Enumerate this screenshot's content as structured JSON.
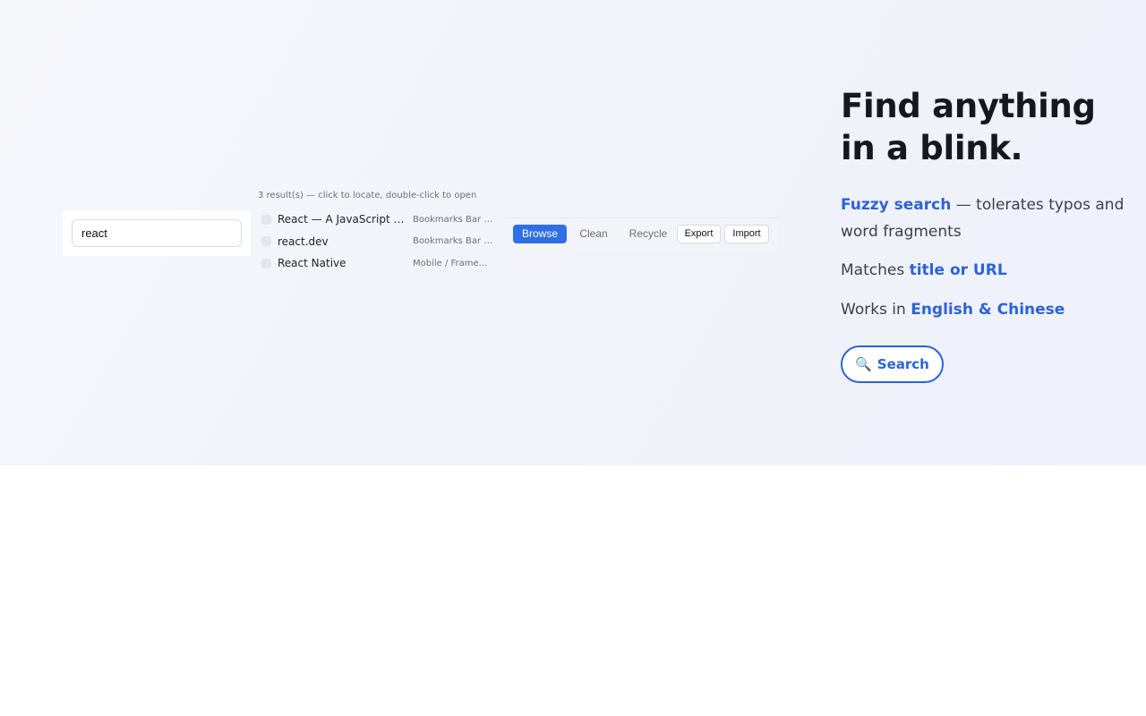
{
  "search": {
    "value": "react"
  },
  "results": {
    "hint": "3 result(s) — click to locate, double-click to open",
    "items": [
      {
        "title": "React — A JavaScript li...",
        "folder": "Bookmarks Bar /..."
      },
      {
        "title": "react.dev",
        "folder": "Bookmarks Bar /..."
      },
      {
        "title": "React Native",
        "folder": "Mobile / Frame..."
      }
    ]
  },
  "toolbar": {
    "browse": "Browse",
    "clean": "Clean",
    "recycle": "Recycle",
    "export": "Export",
    "import": "Import"
  },
  "hero": {
    "headline_line1": "Find anything",
    "headline_line2": "in a blink.",
    "feature1": {
      "highlight": "Fuzzy search",
      "rest": " — tolerates typos and word fragments"
    },
    "feature2": {
      "prefix": "Matches ",
      "highlight": "title or URL"
    },
    "feature3": {
      "prefix": "Works in ",
      "highlight": "English & Chinese"
    },
    "cta": {
      "icon": "search-icon",
      "glyph": "🔍",
      "label": "Search"
    }
  },
  "colors": {
    "accent": "#2c63d8",
    "primary_button": "#2f6fe6",
    "heading": "#15181e"
  }
}
